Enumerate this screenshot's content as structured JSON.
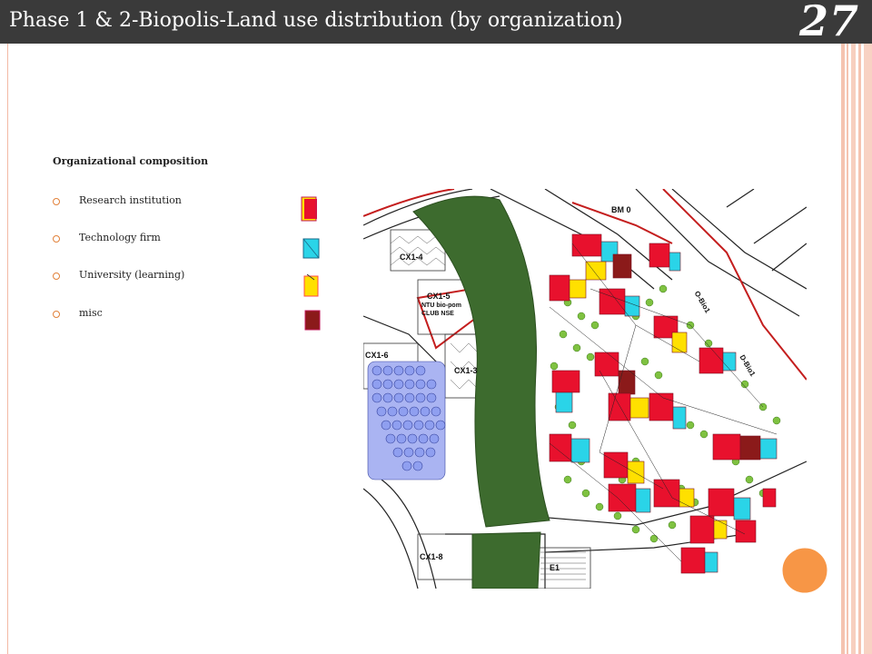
{
  "slide": {
    "title": "Phase 1 & 2-Biopolis-Land use distribution (by organization)",
    "number": "27"
  },
  "legend": {
    "heading": "Organizational composition",
    "items": [
      {
        "label": "Research institution",
        "color": "#e8112d",
        "accent": "#ffe000"
      },
      {
        "label": "Technology firm",
        "color": "#2ad4e8",
        "accent": "#ffe000"
      },
      {
        "label": "University (learning)",
        "color": "#ffe000",
        "accent": "#ff4a4a"
      },
      {
        "label": "misc",
        "color": "#8b1a1a",
        "accent": "#c2185b"
      }
    ]
  },
  "map": {
    "labels": {
      "bm0": "BM 0",
      "cx14": "CX1-4",
      "cx15": "CX1-5",
      "cx15_sub1": "NTU bio-pom",
      "cx15_sub2": "CLUB NSE",
      "cx16": "CX1-6",
      "cx13": "CX1-3",
      "cx18": "CX1-8",
      "e1": "E1",
      "road1": "O-Bio1",
      "road2": "D-Bio1"
    }
  },
  "colors": {
    "title_bar": "#3a3a3a",
    "accent_orange": "#f79646",
    "border_pink": "#f3b9a5"
  }
}
